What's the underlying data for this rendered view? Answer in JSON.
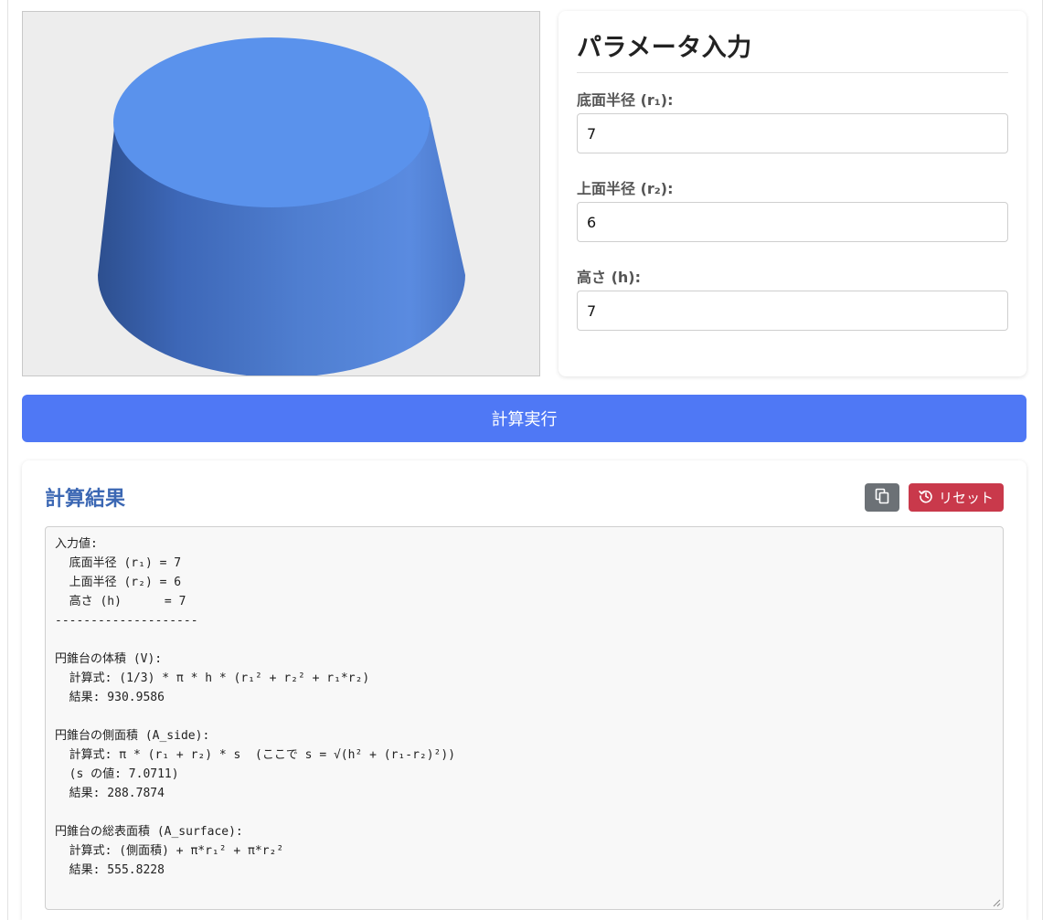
{
  "param_panel": {
    "title": "パラメータ入力",
    "fields": [
      {
        "label": "底面半径 (r₁):",
        "value": "7"
      },
      {
        "label": "上面半径 (r₂):",
        "value": "6"
      },
      {
        "label": "高さ (h):",
        "value": "7"
      }
    ]
  },
  "calc_button": {
    "label": "計算実行"
  },
  "result": {
    "title": "計算結果",
    "reset_label": "リセット",
    "lines": [
      "入力値:",
      "  底面半径 (r₁) = 7",
      "  上面半径 (r₂) = 6",
      "  高さ (h)      = 7",
      "--------------------",
      "",
      "円錐台の体積 (V):",
      "  計算式: (1/3) * π * h * (r₁² + r₂² + r₁*r₂)",
      "  結果: 930.9586",
      "",
      "円錐台の側面積 (A_side):",
      "  計算式: π * (r₁ + r₂) * s  (ここで s = √(h² + (r₁-r₂)²))",
      "  (s の値: 7.0711)",
      "  結果: 288.7874",
      "",
      "円錐台の総表面積 (A_surface):",
      "  計算式: (側面積) + π*r₁² + π*r₂²",
      "  結果: 555.8228"
    ]
  },
  "icons": {
    "copy": "copy-icon",
    "reset": "history-icon"
  },
  "colors": {
    "accent": "#4f78f5",
    "result_title": "#3b67b3",
    "reset_button": "#c9394b",
    "copy_button": "#6c7176",
    "frustum_top": "#5a92ec"
  }
}
